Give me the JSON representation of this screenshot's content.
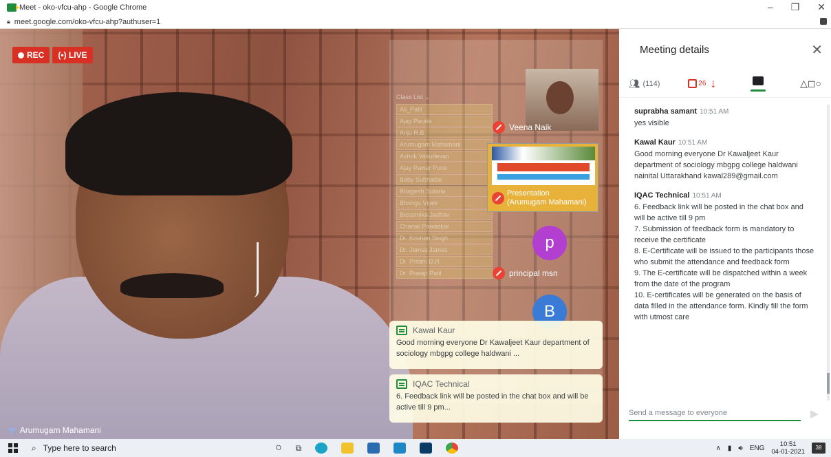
{
  "window": {
    "title": "Meet - oko-vfcu-ahp - Google Chrome",
    "url": "meet.google.com/oko-vfcu-ahp?authuser=1",
    "controls": [
      "–",
      "❐",
      "✕"
    ]
  },
  "video": {
    "rec_label": "REC",
    "live_label": "LIVE",
    "speaker_name": "Arumugam Mahamani"
  },
  "overlay": {
    "class_list_title": "Class List ⌄",
    "class_list": [
      "Ali_Patil",
      "Ajay Parate",
      "Anju R.B.",
      "Arumugam Mahamani",
      "Ashok Vasudevan",
      "Ajay Pawar Pune",
      "Baby Subhadar",
      "Bhagesh Sutaria",
      "Bhringu Vivek",
      "Biccomika Jadhav",
      "Chaitali Pawaskar",
      "Dr. Krishan Singh",
      "Dr. Jamsa James",
      "Dr. Pritam D.R",
      "Dr. Pratap Patil"
    ],
    "participant1": "Veena Naik",
    "participant2": "principal msn",
    "presentation_line1": "Presentation",
    "presentation_line2": "(Arumugam Mahamani)",
    "avatar_p": "p",
    "avatar_b": "B",
    "colors": {
      "avatar_p": "#b33fd1",
      "avatar_b": "#3a7bd5",
      "accent_red": "#d93025",
      "accent_green": "#1e8e3e"
    }
  },
  "toasts": [
    {
      "sender": "Kawal Kaur",
      "text": "Good morning everyone Dr Kawaljeet Kaur department of sociology mbgpg college haldwani ..."
    },
    {
      "sender": "IQAC Technical",
      "text": "6.   Feedback link will be posted in the chat box and will be active till 9 pm..."
    }
  ],
  "side_panel": {
    "title": "Meeting details",
    "people_count": "(114)",
    "attendance_count": "26",
    "messages": [
      {
        "sender": "suprabha samant",
        "time": "10:51 AM",
        "lines": [
          "yes visible"
        ]
      },
      {
        "sender": "Kawal Kaur",
        "time": "10:51 AM",
        "lines": [
          "Good morning everyone Dr Kawaljeet Kaur department of sociology mbgpg college haldwani nainital Uttarakhand kawal289@gmail.com"
        ]
      },
      {
        "sender": "IQAC Technical",
        "time": "10:51 AM",
        "lines": [
          "6.   Feedback link will be posted in the chat box and will be active till 9 pm",
          "7.   Submission of feedback form is mandatory to receive the certificate",
          "8.   E-Certificate will be issued to the participants those who submit the attendance and feedback form",
          "9.   The E-certificate will be dispatched within a week from the date of the program",
          "10.  E-certificates will be generated on the basis of data filled in the attendance form. Kindly fill the form with utmost care"
        ]
      }
    ],
    "input_placeholder": "Send a message to everyone"
  },
  "taskbar": {
    "search_placeholder": "Type here to search",
    "language": "ENG",
    "time": "10:51",
    "date": "04-01-2021",
    "notifications": "38"
  }
}
